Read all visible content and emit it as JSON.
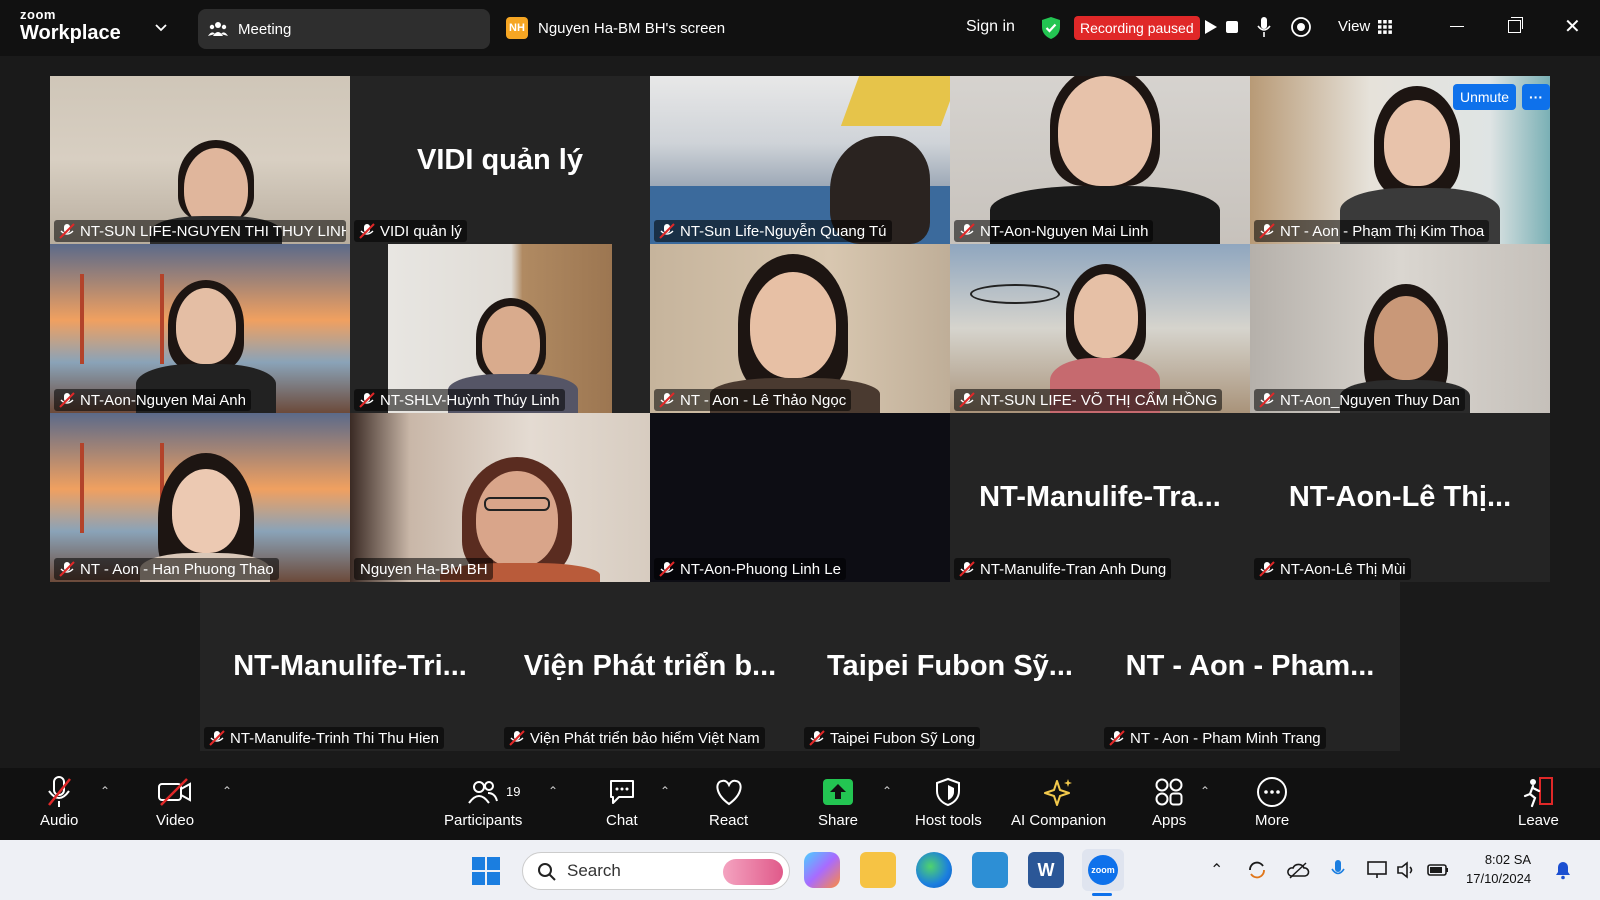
{
  "topbar": {
    "logo_top": "zoom",
    "logo_bottom": "Workplace",
    "meeting_label": "Meeting",
    "sharer_initials": "NH",
    "sharer_text": "Nguyen Ha-BM BH's screen",
    "sign_in": "Sign in",
    "recording": "Recording paused",
    "view": "View"
  },
  "tiles": [
    {
      "name": "NT-SUN LIFE-NGUYEN THI THUY LINH"
    },
    {
      "name": "VIDI quản lý",
      "big": "VIDI quản lý"
    },
    {
      "name": "NT-Sun Life-Nguyễn Quang Tú"
    },
    {
      "name": "NT-Aon-Nguyen Mai Linh"
    },
    {
      "name": "NT - Aon - Phạm Thị Kim Thoa"
    },
    {
      "name": "NT-Aon-Nguyen Mai Anh"
    },
    {
      "name": "NT-SHLV-Huỳnh Thúy Linh"
    },
    {
      "name": "NT - Aon - Lê Thảo Ngọc"
    },
    {
      "name": "NT-SUN LIFE- VÕ THỊ CẨM HỒNG"
    },
    {
      "name": "NT-Aon_Nguyen Thuy Dan"
    },
    {
      "name": "NT - Aon - Han Phuong Thao"
    },
    {
      "name": "Nguyen Ha-BM BH"
    },
    {
      "name": "NT-Aon-Phuong Linh Le"
    },
    {
      "name": "NT-Manulife-Tran Anh Dung",
      "big": "NT-Manulife-Tra..."
    },
    {
      "name": "NT-Aon-Lê Thị Mùi",
      "big": "NT-Aon-Lê Thị..."
    },
    {
      "name": "NT-Manulife-Trinh Thi Thu Hien",
      "big": "NT-Manulife-Tri..."
    },
    {
      "name": "Viện Phát triển bảo hiểm Việt Nam",
      "big": "Viện Phát triển b..."
    },
    {
      "name": "Taipei Fubon Sỹ Long",
      "big": "Taipei Fubon Sỹ..."
    },
    {
      "name": "NT - Aon - Pham Minh Trang",
      "big": "NT - Aon - Pham..."
    }
  ],
  "tile_actions": {
    "unmute": "Unmute",
    "more": "···"
  },
  "toolbar": {
    "audio": "Audio",
    "video": "Video",
    "participants": "Participants",
    "participants_count": "19",
    "chat": "Chat",
    "react": "React",
    "share": "Share",
    "host_tools": "Host tools",
    "ai_companion": "AI Companion",
    "apps": "Apps",
    "more": "More",
    "leave": "Leave"
  },
  "taskbar": {
    "search_placeholder": "Search",
    "time": "8:02 SA",
    "date": "17/10/2024"
  },
  "colors": {
    "recording_red": "#e02828",
    "active_speaker": "#2ecc71",
    "unmute_blue": "#0e71eb",
    "share_green": "#23c552"
  }
}
